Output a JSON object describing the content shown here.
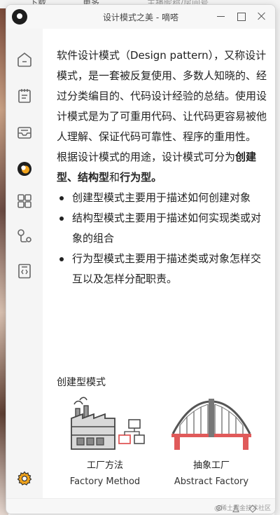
{
  "background": {
    "menu_download": "下载",
    "menu_more": "更多",
    "search_placeholder": "主播昵称/房间号"
  },
  "window": {
    "title": "设计模式之美 - 嘀嗒"
  },
  "sidebar": {
    "items": [
      {
        "icon": "home-icon",
        "name": "home"
      },
      {
        "icon": "notes-icon",
        "name": "notes"
      },
      {
        "icon": "inbox-icon",
        "name": "inbox"
      },
      {
        "icon": "focus-icon",
        "name": "focus"
      },
      {
        "icon": "apps-icon",
        "name": "apps"
      },
      {
        "icon": "share-icon",
        "name": "graph"
      },
      {
        "icon": "code-file-icon",
        "name": "code"
      }
    ],
    "settings_icon": "gear-icon"
  },
  "article": {
    "intro": "软件设计模式（Design pattern），又称设计模式，是一套被反复使用、多数人知晓的、经过分类编目的、代码设计经验的总结。使用设计模式是为了可重用代码、让代码更容易被他人理解、保证代码可靠性、程序的重用性。",
    "classify_lead": "根据设计模式的用途，设计模式可分为",
    "type_creational": "创建型",
    "sep1": "、",
    "type_structural": "结构型",
    "sep2": "和",
    "type_behavioral": "行为型",
    "end_mark": "。",
    "bullets": [
      "创建型模式主要用于描述如何创建对象",
      "结构型模式主要用于描述如何实现类或对象的组合",
      "行为型模式主要用于描述类或对象怎样交互以及怎样分配职责。"
    ]
  },
  "creational_section": {
    "heading": "创建型模式",
    "patterns": [
      {
        "cn": "工厂方法",
        "en": "Factory Method",
        "icon": "factory-icon"
      },
      {
        "cn": "抽象工厂",
        "en": "Abstract Factory",
        "icon": "bridge-icon"
      }
    ]
  },
  "statusbar": {
    "watermark": "@稀土掘金技术社区"
  },
  "colors": {
    "accent_red": "#e05a5a",
    "accent_orange": "#f0a31c"
  }
}
